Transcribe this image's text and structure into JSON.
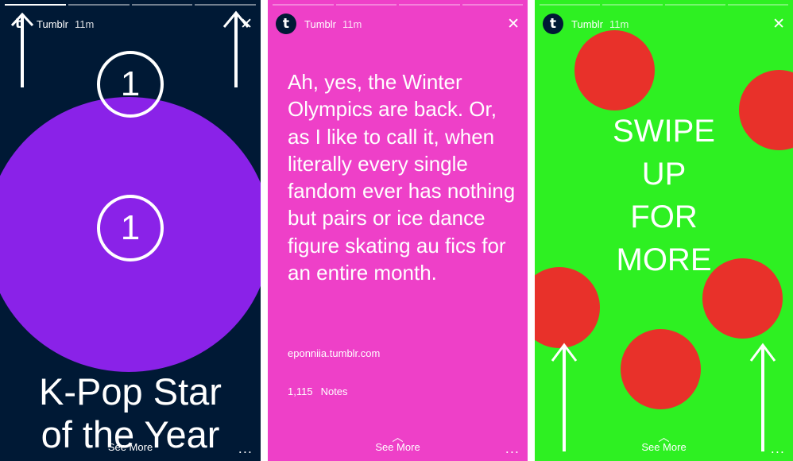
{
  "stories": [
    {
      "account": "Tumblr",
      "time": "11m",
      "badge_number": "1",
      "title_line1": "K-Pop Star",
      "title_line2": "of the Year",
      "see_more": "See More",
      "more": "...",
      "colors": {
        "background": "#001935",
        "circle": "#8a22e8"
      }
    },
    {
      "account": "Tumblr",
      "time": "11m",
      "quote": "Ah, yes, the Winter Olympics are back. Or, as I like to call it, when literally every single fandom ever has nothing but pairs or ice dance figure skating au fics for an entire month.",
      "source": "eponniia.tumblr.com",
      "notes_count": "1,115",
      "notes_label": "Notes",
      "see_more": "See More",
      "more": "...",
      "colors": {
        "background": "#ee40c8"
      }
    },
    {
      "account": "Tumblr",
      "time": "11m",
      "cta": [
        "SWIPE",
        "UP",
        "FOR",
        "MORE"
      ],
      "see_more": "See More",
      "more": "...",
      "colors": {
        "background": "#2ef022",
        "dots": "#e8312a"
      }
    }
  ],
  "icons": {
    "logo": "tumblr-t-icon",
    "close": "close-icon",
    "chevron": "chevron-up-icon",
    "arrow": "arrow-up-icon",
    "more": "more-dots-icon"
  },
  "glyphs": {
    "logo": "t",
    "close": "✕",
    "chevron": "︿"
  }
}
